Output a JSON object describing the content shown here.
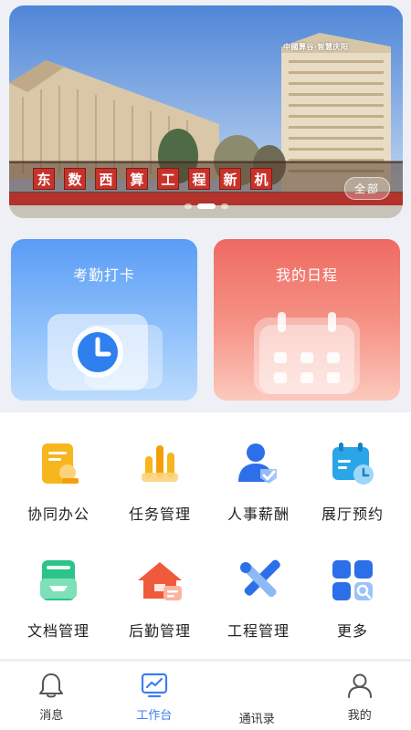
{
  "banner": {
    "sign_chars": [
      "东",
      "数",
      "西",
      "算",
      "工",
      "程",
      "新",
      "机"
    ],
    "building_sign": "中國算谷·智慧庆阳",
    "view_all": "全部",
    "pager_count": 3,
    "pager_active": 1
  },
  "cards": {
    "attendance": {
      "title": "考勤打卡"
    },
    "schedule": {
      "title": "我的日程"
    }
  },
  "grid": [
    {
      "label": "协同办公",
      "icon": "document-stamp-icon"
    },
    {
      "label": "任务管理",
      "icon": "task-bars-icon"
    },
    {
      "label": "人事薪酬",
      "icon": "person-check-icon"
    },
    {
      "label": "展厅预约",
      "icon": "calendar-clock-icon"
    },
    {
      "label": "文档管理",
      "icon": "archive-box-icon"
    },
    {
      "label": "后勤管理",
      "icon": "home-logistics-icon"
    },
    {
      "label": "工程管理",
      "icon": "tools-icon"
    },
    {
      "label": "更多",
      "icon": "more-apps-icon"
    }
  ],
  "tabs": [
    {
      "label": "消息",
      "icon": "bell-icon",
      "active": false
    },
    {
      "label": "工作台",
      "icon": "chart-monitor-icon",
      "active": true
    },
    {
      "label": "通讯录",
      "icon": "",
      "active": false
    },
    {
      "label": "我的",
      "icon": "user-icon",
      "active": false
    }
  ],
  "colors": {
    "accent": "#3d7ef0",
    "attendance_card": "#5a9cf5",
    "schedule_card": "#ee6a62"
  }
}
